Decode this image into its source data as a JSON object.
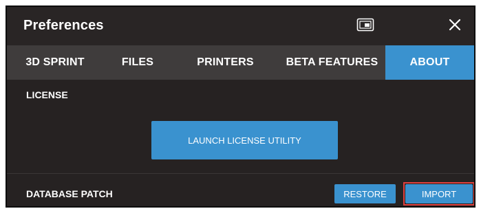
{
  "window": {
    "title": "Preferences",
    "restore_icon": "window-restore-icon",
    "close_icon": "close-icon"
  },
  "tabs": [
    {
      "label": "3D SPRINT",
      "active": false
    },
    {
      "label": "FILES",
      "active": false
    },
    {
      "label": "PRINTERS",
      "active": false
    },
    {
      "label": "BETA FEATURES",
      "active": false
    },
    {
      "label": "ABOUT",
      "active": true
    }
  ],
  "license": {
    "heading": "LICENSE",
    "button_label": "LAUNCH LICENSE UTILITY"
  },
  "database_patch": {
    "heading": "DATABASE PATCH",
    "restore_label": "RESTORE",
    "import_label": "IMPORT"
  },
  "colors": {
    "accent": "#3a92cf",
    "background": "#262222",
    "tab_bar": "#3f3c3c",
    "highlight": "#e0403e"
  }
}
